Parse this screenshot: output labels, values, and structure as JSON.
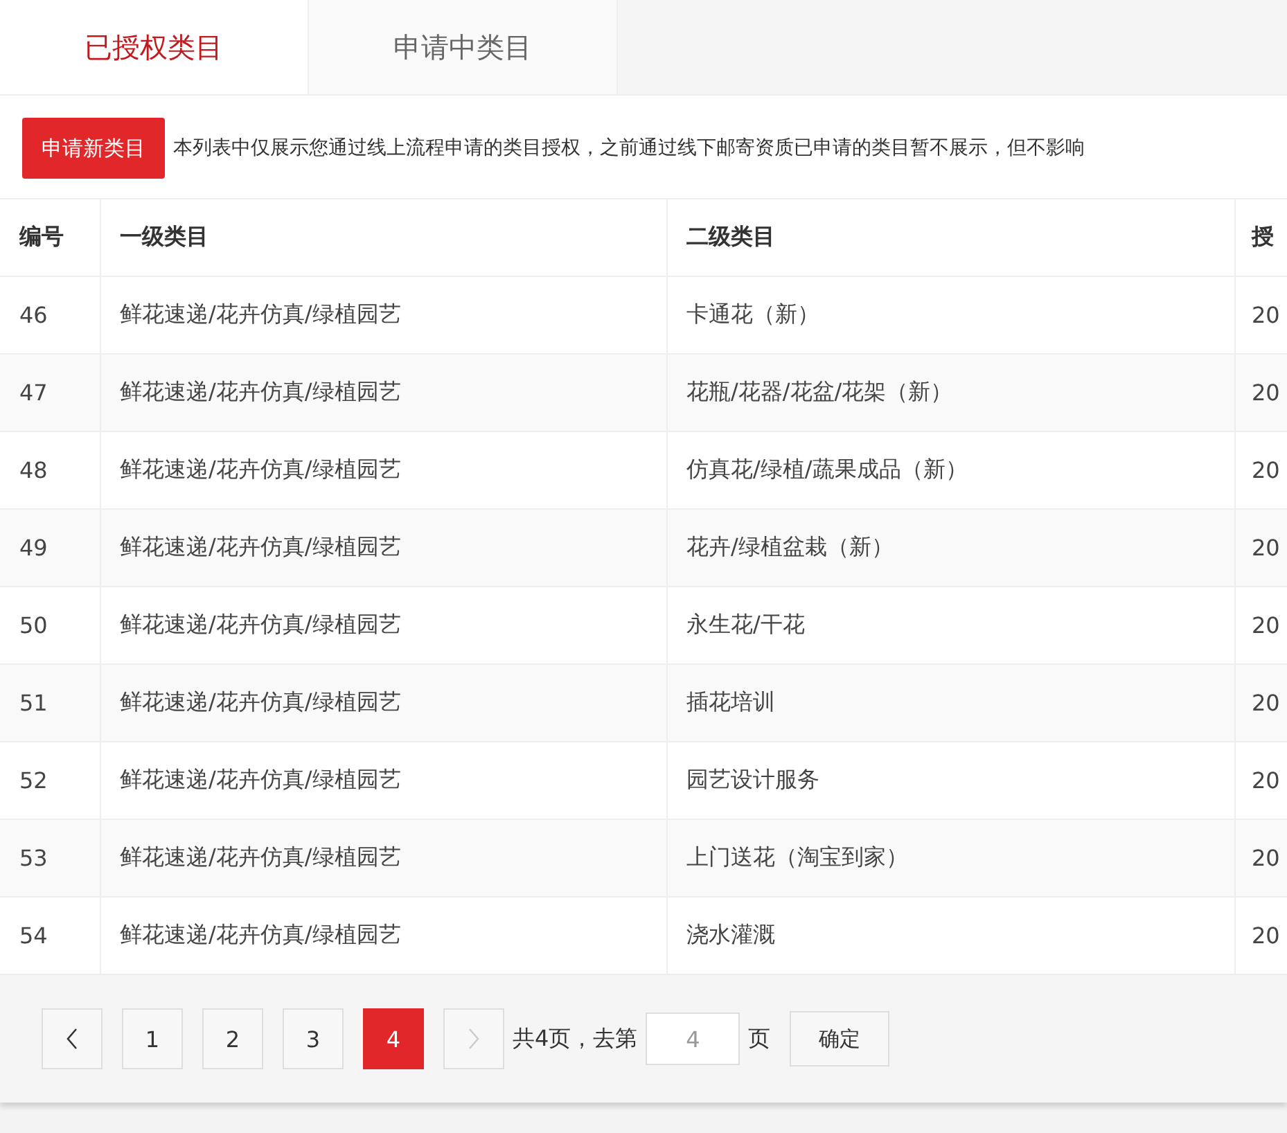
{
  "tabs": [
    {
      "label": "已授权类目",
      "selected": true
    },
    {
      "label": "申请中类目",
      "selected": false
    }
  ],
  "toolbar": {
    "apply_button": "申请新类目",
    "notice": "本列表中仅展示您通过线上流程申请的类目授权，之前通过线下邮寄资质已申请的类目暂不展示，但不影响"
  },
  "table": {
    "columns": [
      "编号",
      "一级类目",
      "二级类目",
      "授"
    ],
    "rows": [
      [
        "46",
        "鲜花速递/花卉仿真/绿植园艺",
        "卡通花（新）",
        "20"
      ],
      [
        "47",
        "鲜花速递/花卉仿真/绿植园艺",
        "花瓶/花器/花盆/花架（新）",
        "20"
      ],
      [
        "48",
        "鲜花速递/花卉仿真/绿植园艺",
        "仿真花/绿植/蔬果成品（新）",
        "20"
      ],
      [
        "49",
        "鲜花速递/花卉仿真/绿植园艺",
        "花卉/绿植盆栽（新）",
        "20"
      ],
      [
        "50",
        "鲜花速递/花卉仿真/绿植园艺",
        "永生花/干花",
        "20"
      ],
      [
        "51",
        "鲜花速递/花卉仿真/绿植园艺",
        "插花培训",
        "20"
      ],
      [
        "52",
        "鲜花速递/花卉仿真/绿植园艺",
        "园艺设计服务",
        "20"
      ],
      [
        "53",
        "鲜花速递/花卉仿真/绿植园艺",
        "上门送花（淘宝到家）",
        "20"
      ],
      [
        "54",
        "鲜花速递/花卉仿真/绿植园艺",
        "浇水灌溉",
        "20"
      ]
    ]
  },
  "pagination": {
    "prev": {
      "disabled": false
    },
    "pages": [
      {
        "label": "1",
        "selected": false
      },
      {
        "label": "2",
        "selected": false
      },
      {
        "label": "3",
        "selected": false
      },
      {
        "label": "4",
        "selected": true
      }
    ],
    "next": {
      "disabled": true
    },
    "total_text": "共4页，去第",
    "page_input": "4",
    "page_suffix": "页",
    "confirm_button": "确定"
  }
}
